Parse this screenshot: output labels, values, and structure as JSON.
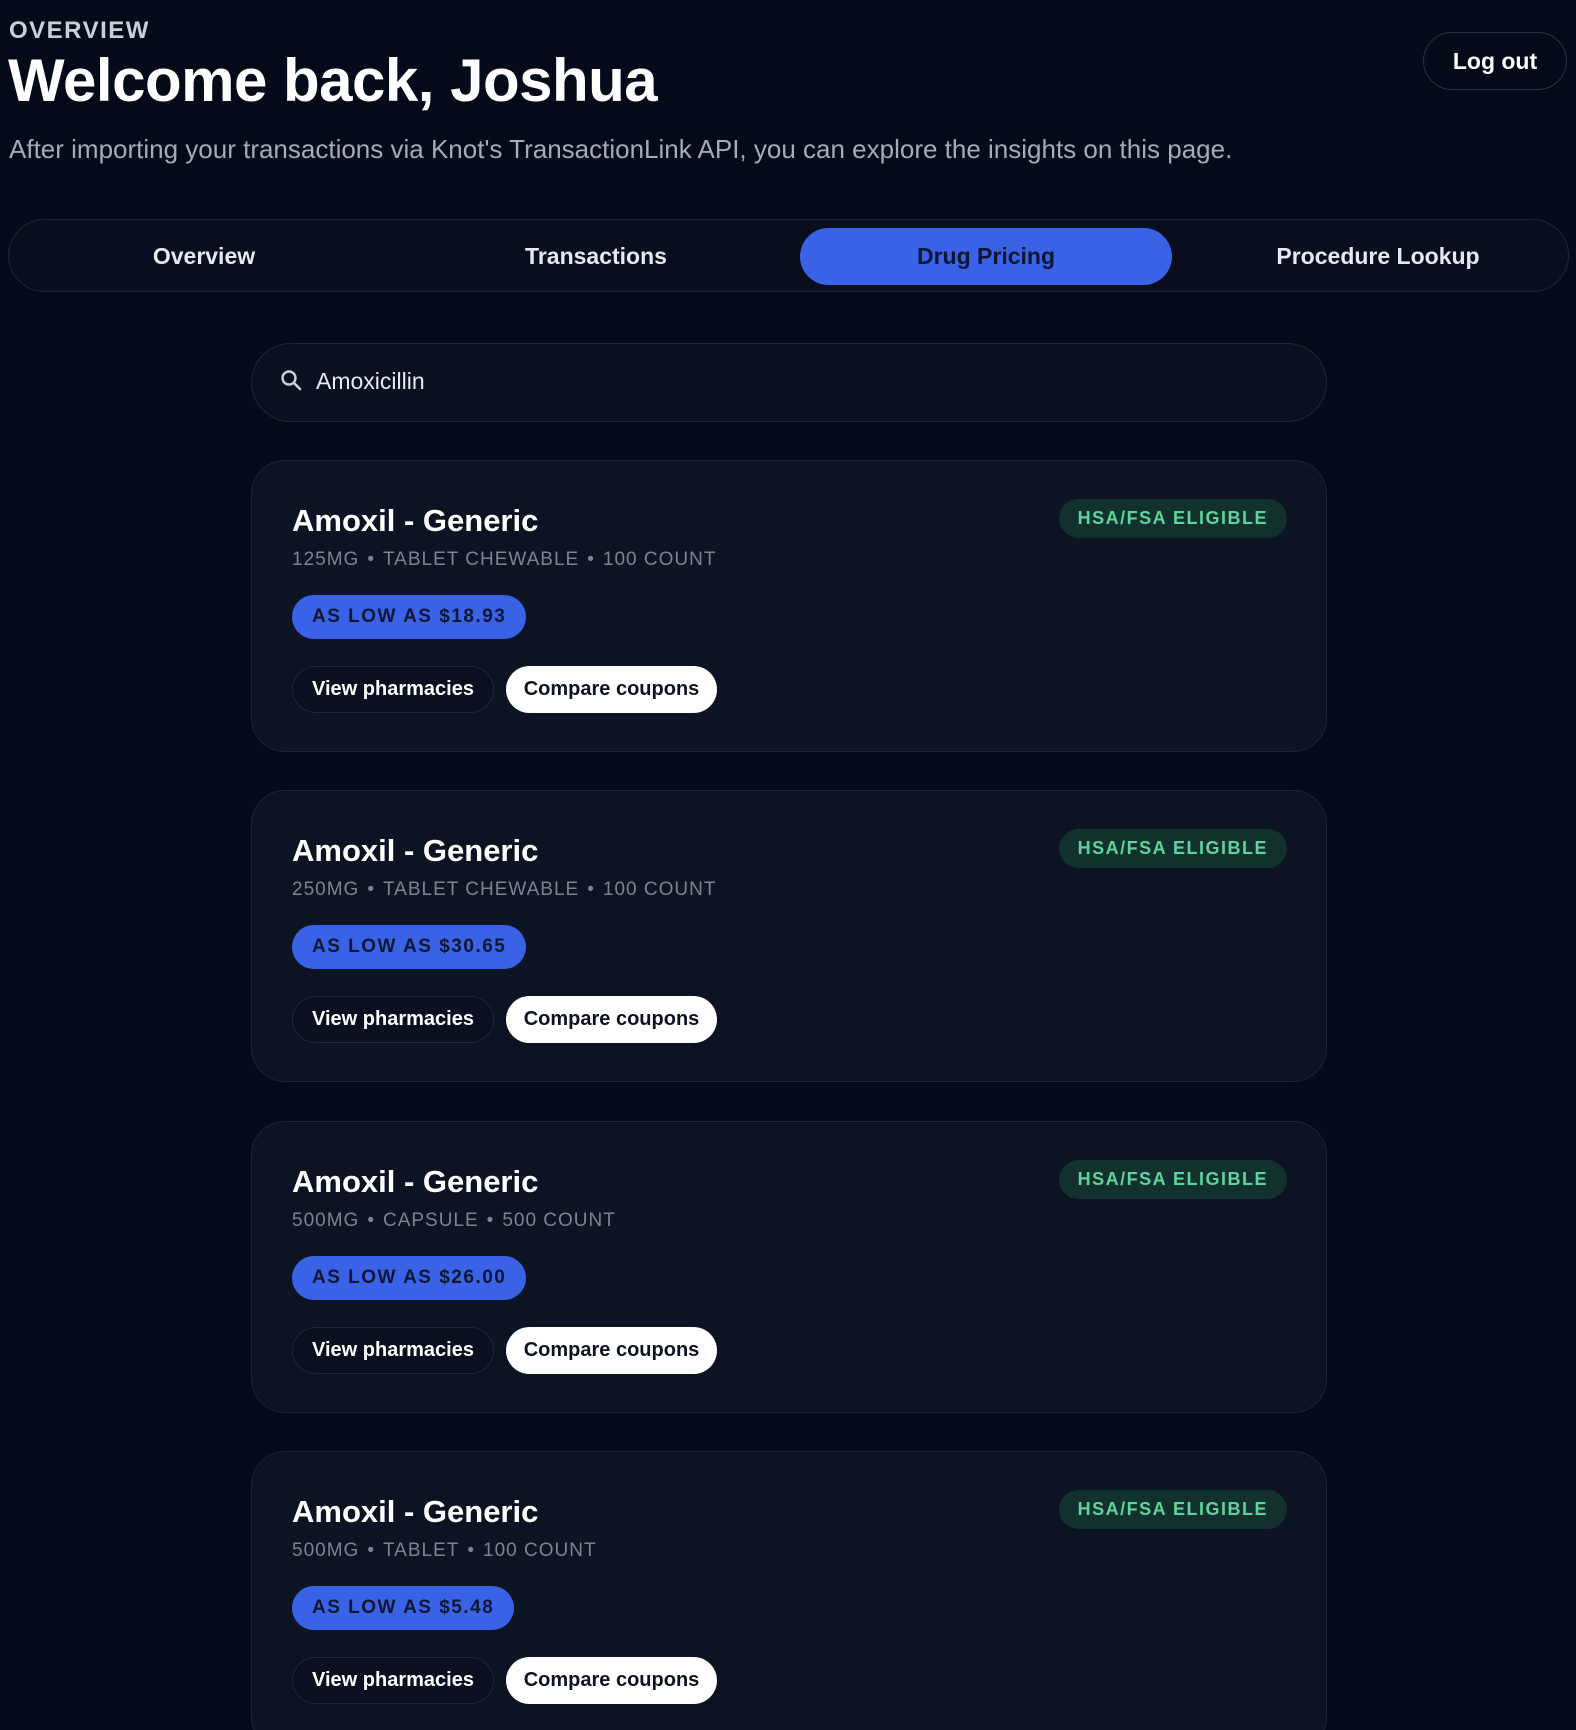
{
  "header": {
    "eyebrow": "OVERVIEW",
    "title": "Welcome back, Joshua",
    "subtitle": "After importing your transactions via Knot's TransactionLink API, you can explore the insights on this page.",
    "logout_label": "Log out"
  },
  "tabs": [
    {
      "label": "Overview",
      "active": false
    },
    {
      "label": "Transactions",
      "active": false
    },
    {
      "label": "Drug Pricing",
      "active": true
    },
    {
      "label": "Procedure Lookup",
      "active": false
    }
  ],
  "search": {
    "icon": "search-icon",
    "value": "Amoxicillin"
  },
  "results": [
    {
      "name": "Amoxil - Generic",
      "strength": "125MG",
      "form": "TABLET CHEWABLE",
      "count": "100 COUNT",
      "price_label": "AS LOW AS $18.93",
      "badge": "HSA/FSA ELIGIBLE",
      "view_label": "View pharmacies",
      "compare_label": "Compare coupons"
    },
    {
      "name": "Amoxil - Generic",
      "strength": "250MG",
      "form": "TABLET CHEWABLE",
      "count": "100 COUNT",
      "price_label": "AS LOW AS $30.65",
      "badge": "HSA/FSA ELIGIBLE",
      "view_label": "View pharmacies",
      "compare_label": "Compare coupons"
    },
    {
      "name": "Amoxil - Generic",
      "strength": "500MG",
      "form": "CAPSULE",
      "count": "500 COUNT",
      "price_label": "AS LOW AS $26.00",
      "badge": "HSA/FSA ELIGIBLE",
      "view_label": "View pharmacies",
      "compare_label": "Compare coupons"
    },
    {
      "name": "Amoxil - Generic",
      "strength": "500MG",
      "form": "TABLET",
      "count": "100 COUNT",
      "price_label": "AS LOW AS $5.48",
      "badge": "HSA/FSA ELIGIBLE",
      "view_label": "View pharmacies",
      "compare_label": "Compare coupons"
    }
  ],
  "colors": {
    "background": "#050a18",
    "accent": "#3a62e6",
    "badge_text": "#5fd3a0",
    "badge_bg": "#12302c"
  }
}
